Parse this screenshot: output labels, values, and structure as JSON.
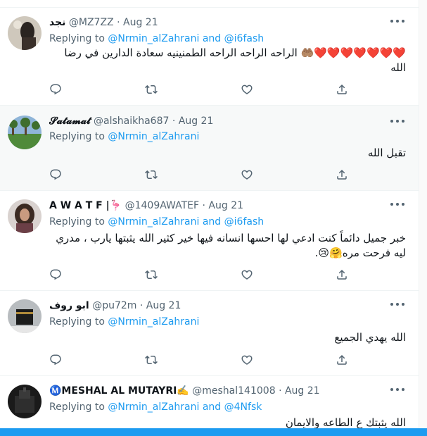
{
  "tweets": [
    {
      "name": "نجد",
      "handle": "@MZ7ZZ",
      "sep": "·",
      "time": "Aug 21",
      "replying_prefix": "Replying to ",
      "mention1": "@Nrmin_alZahrani",
      "and": " and ",
      "mention2": "@i6fash",
      "text": "❤️❤️❤️❤️❤️❤️❤️🤲🏽 الراحه الراحه الراحه الطمنينيه سعادة الدارين في رضا الله"
    },
    {
      "name": "𝓢𝓪𝓽𝓪𝓶𝓪𝓽",
      "handle": "@alshaikha687",
      "sep": "·",
      "time": "Aug 21",
      "replying_prefix": "Replying to ",
      "mention1": "@Nrmin_alZahrani",
      "text": "تقبل الله"
    },
    {
      "name": "A W A T F |🦩",
      "handle": "@1409AWATEF",
      "sep": "·",
      "time": "Aug 21",
      "replying_prefix": "Replying to ",
      "mention1": "@Nrmin_alZahrani",
      "and": " and ",
      "mention2": "@i6fash",
      "text": "خبر جميل دائماً كنت ادعي لها احسها انسانه فيها خير كثير الله يثبتها يارب ، مدري ليه فرحت مره🤗😢."
    },
    {
      "name": "ابو روف",
      "handle": "@pu72m",
      "sep": "·",
      "time": "Aug 21",
      "replying_prefix": "Replying to ",
      "mention1": "@Nrmin_alZahrani",
      "text": "الله يهدي الجميع"
    },
    {
      "name": "Ⓜ️MESHAL AL MUTAYRI✍️",
      "handle": "@meshal141008",
      "sep": "·",
      "time": "Aug 21",
      "replying_prefix": "Replying to ",
      "mention1": "@Nrmin_alZahrani",
      "and": " and ",
      "mention2": "@4Nfsk",
      "text": "الله يثبتك ع الطاعه والايمان"
    }
  ],
  "icons": {
    "reply": "reply-icon",
    "retweet": "retweet-icon",
    "like": "like-icon",
    "share": "share-icon",
    "more": "more-icon"
  },
  "colors": {
    "link": "#1d9bf0",
    "secondary": "#536471",
    "highlight_bg": "#f7f9f9",
    "divider": "#eff3f4"
  }
}
